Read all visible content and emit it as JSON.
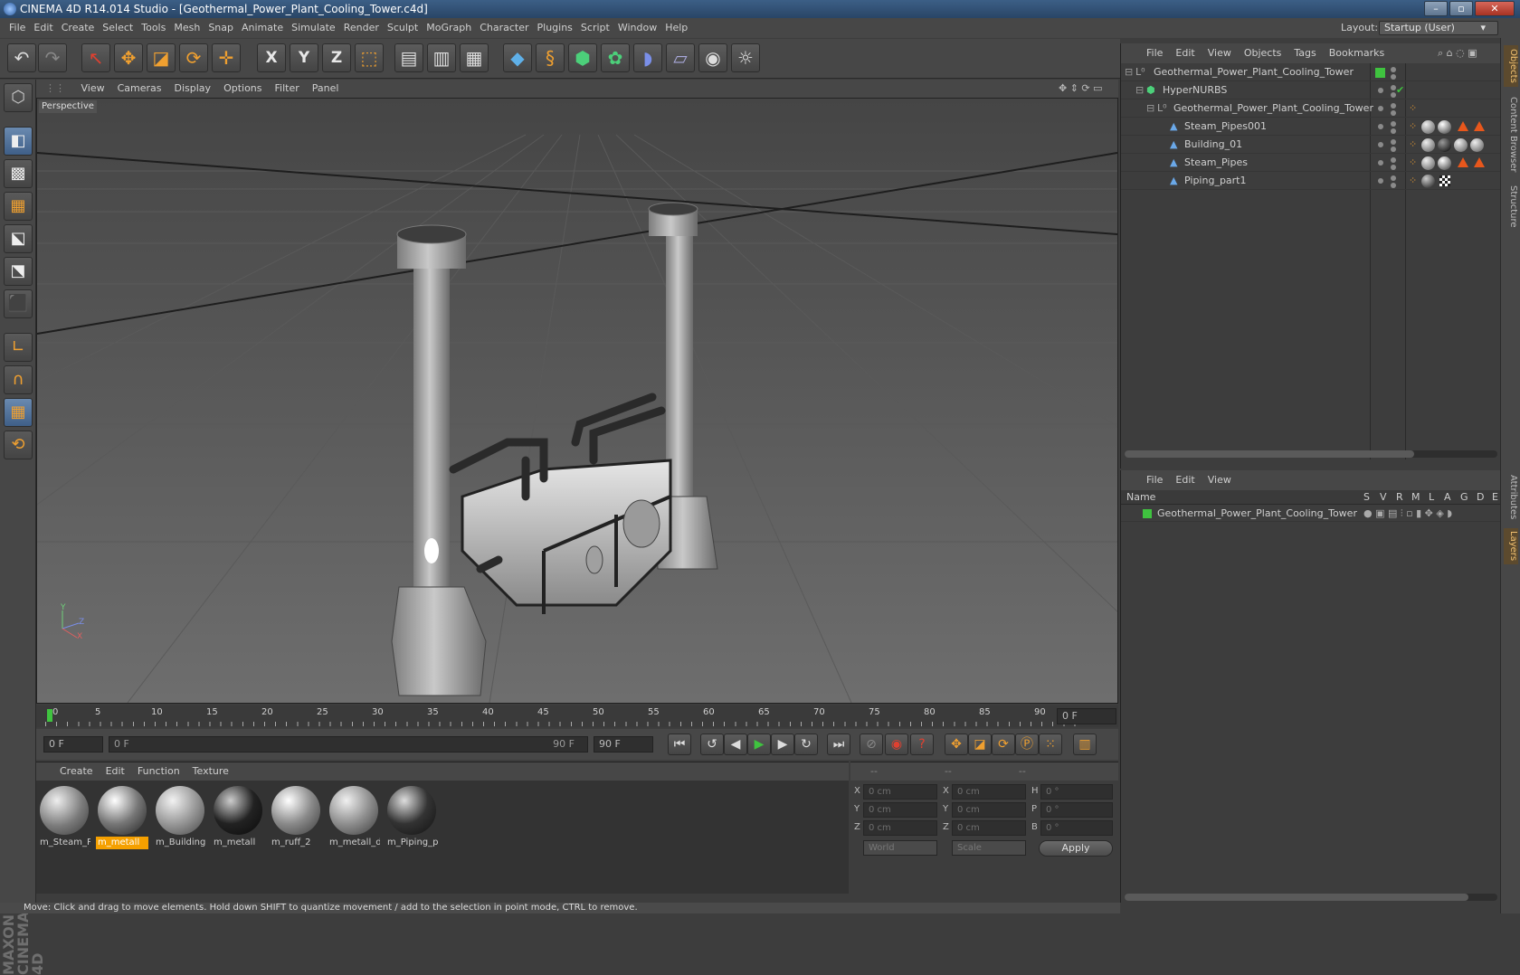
{
  "window": {
    "title": "CINEMA 4D R14.014 Studio - [Geothermal_Power_Plant_Cooling_Tower.c4d]",
    "min": "–",
    "max": "▫",
    "close": "✕"
  },
  "menubar": {
    "items": [
      "File",
      "Edit",
      "Create",
      "Select",
      "Tools",
      "Mesh",
      "Snap",
      "Animate",
      "Simulate",
      "Render",
      "Sculpt",
      "MoGraph",
      "Character",
      "Plugins",
      "Script",
      "Window",
      "Help"
    ],
    "layout_label": "Layout:",
    "layout_value": "Startup (User)"
  },
  "toolbar": {
    "axis_x": "X",
    "axis_y": "Y",
    "axis_z": "Z"
  },
  "viewport": {
    "menu": [
      "View",
      "Cameras",
      "Display",
      "Options",
      "Filter",
      "Panel"
    ],
    "label": "Perspective",
    "axis_y": "Y",
    "axis_z": "Z",
    "axis_x": "X"
  },
  "timeline": {
    "ticks": [
      "0",
      "5",
      "10",
      "15",
      "20",
      "25",
      "30",
      "35",
      "40",
      "45",
      "50",
      "55",
      "60",
      "65",
      "70",
      "75",
      "80",
      "85",
      "90"
    ],
    "current": "0 F"
  },
  "transport": {
    "start": "0 F",
    "range_start": "0 F",
    "range_end": "90 F",
    "end": "90 F"
  },
  "materials": {
    "menu": [
      "Create",
      "Edit",
      "Function",
      "Texture"
    ],
    "items": [
      {
        "name": "m_Steam_P",
        "selected": false
      },
      {
        "name": "m_metall",
        "selected": true
      },
      {
        "name": "m_Building",
        "selected": false
      },
      {
        "name": "m_metall",
        "selected": false
      },
      {
        "name": "m_ruff_2",
        "selected": false
      },
      {
        "name": "m_metall_d",
        "selected": false
      },
      {
        "name": "m_Piping_p",
        "selected": false
      }
    ]
  },
  "coords": {
    "headers": [
      "--",
      "--",
      "--"
    ],
    "rows": [
      {
        "l1": "X",
        "v1": "0 cm",
        "l2": "X",
        "v2": "0 cm",
        "l3": "H",
        "v3": "0 °"
      },
      {
        "l1": "Y",
        "v1": "0 cm",
        "l2": "Y",
        "v2": "0 cm",
        "l3": "P",
        "v3": "0 °"
      },
      {
        "l1": "Z",
        "v1": "0 cm",
        "l2": "Z",
        "v2": "0 cm",
        "l3": "B",
        "v3": "0 °"
      }
    ],
    "mode1": "World",
    "mode2": "Scale",
    "apply": "Apply"
  },
  "status": "Move: Click and drag to move elements. Hold down SHIFT to quantize movement / add to the selection in point mode, CTRL to remove.",
  "objects": {
    "menu": [
      "File",
      "Edit",
      "View",
      "Objects",
      "Tags",
      "Bookmarks"
    ],
    "tree": [
      {
        "name": "Geothermal_Power_Plant_Cooling_Tower",
        "indent": 0
      },
      {
        "name": "HyperNURBS",
        "indent": 1
      },
      {
        "name": "Geothermal_Power_Plant_Cooling_Tower",
        "indent": 2
      },
      {
        "name": "Steam_Pipes001",
        "indent": 3
      },
      {
        "name": "Building_01",
        "indent": 3
      },
      {
        "name": "Steam_Pipes",
        "indent": 3
      },
      {
        "name": "Piping_part1",
        "indent": 3
      }
    ]
  },
  "layers": {
    "menu": [
      "File",
      "Edit",
      "View"
    ],
    "col_name": "Name",
    "cols": [
      "S",
      "V",
      "R",
      "M",
      "L",
      "A",
      "G",
      "D",
      "E"
    ],
    "rows": [
      {
        "name": "Geothermal_Power_Plant_Cooling_Tower"
      }
    ]
  },
  "side_tabs": [
    "Objects",
    "Content Browser",
    "Structure",
    "Attributes",
    "Layers"
  ],
  "brand": "MAXON CINEMA 4D",
  "colors": {
    "accent": "#f0a030",
    "select": "#f5a000",
    "layer_green": "#3fc33f"
  }
}
